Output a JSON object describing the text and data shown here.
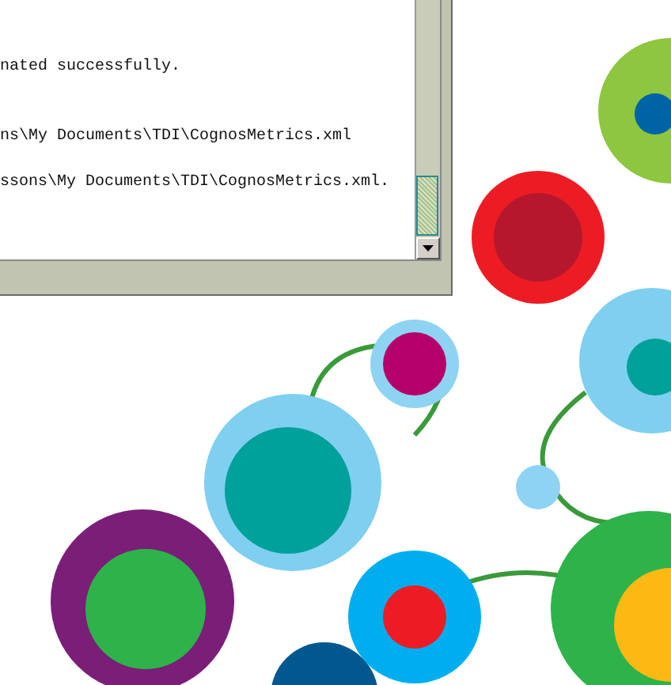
{
  "log": {
    "lines": [
      {
        "text": "nated successfully."
      },
      {
        "text": "ns\\My Documents\\TDI\\CognosMetrics.xml"
      },
      {
        "text": "ssons\\My Documents\\TDI\\CognosMetrics.xml."
      }
    ]
  }
}
